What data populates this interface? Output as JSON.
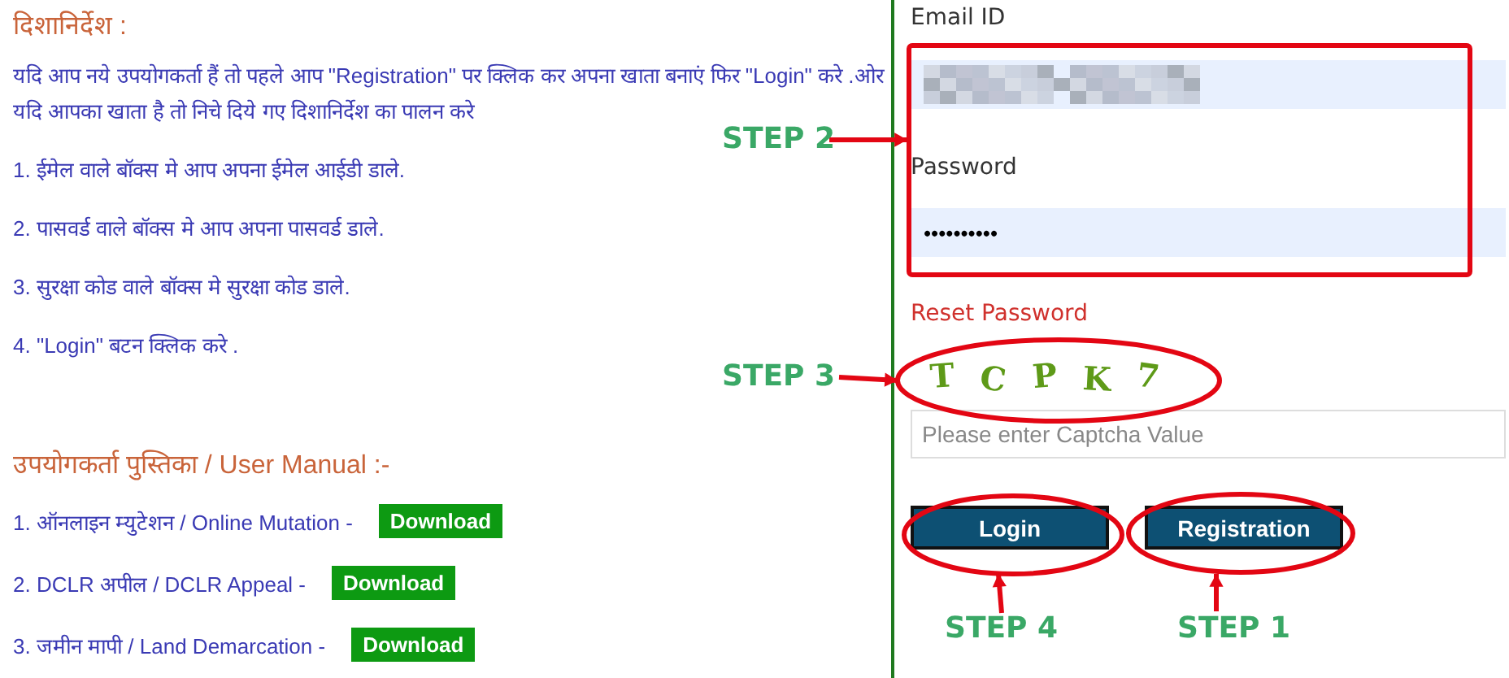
{
  "guidelines": {
    "title": "दिशानिर्देश :",
    "intro": "यदि आप नये उपयोगकर्ता हैं तो पहले आप \"Registration\" पर क्लिक कर अपना खाता बनाएं फिर \"Login\" करे .ओर यदि आपका खाता है तो निचे दिये गए दिशानिर्देश का पालन करे",
    "steps": [
      "1. ईमेल वाले बॉक्स मे आप अपना ईमेल आईडी डाले.",
      "2. पासवर्ड वाले बॉक्स मे आप अपना पासवर्ड डाले.",
      "3. सुरक्षा कोड वाले बॉक्स मे सुरक्षा कोड डाले.",
      "4. \"Login\" बटन क्लिक करे ."
    ]
  },
  "manual": {
    "title": "उपयोगकर्ता पुस्तिका / User Manual :-",
    "items": [
      {
        "label": "1. ऑनलाइन म्युटेशन / Online Mutation -",
        "button": "Download"
      },
      {
        "label": "2. DCLR अपील / DCLR Appeal -",
        "button": "Download"
      },
      {
        "label": "3. जमीन मापी / Land Demarcation -",
        "button": "Download"
      }
    ]
  },
  "login": {
    "email_label": "Email ID",
    "password_label": "Password",
    "password_value": "••••••••••",
    "reset_link": "Reset Password",
    "captcha": [
      "T",
      "C",
      "P",
      "K",
      "7"
    ],
    "captcha_placeholder": "Please enter Captcha Value",
    "buttons": [
      "Login",
      "Registration"
    ]
  },
  "annotations": [
    "STEP 2",
    "STEP 3",
    "STEP 4",
    "STEP 1"
  ]
}
